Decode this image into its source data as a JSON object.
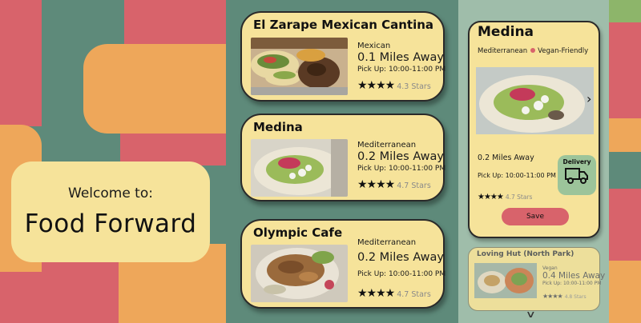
{
  "welcome": {
    "intro": "Welcome to:",
    "app_name": "Food Forward"
  },
  "restaurants": [
    {
      "name": "El Zarape Mexican Cantina",
      "cuisine": "Mexican",
      "distance": "0.1 Miles Away",
      "pickup": "Pick Up: 10:00-11:00 PM",
      "stars": "★★★★",
      "rating": "4.3 Stars"
    },
    {
      "name": "Medina",
      "cuisine": "Mediterranean",
      "distance": "0.2 Miles Away",
      "pickup": "Pick Up: 10:00-11:00 PM",
      "stars": "★★★★",
      "rating": "4.7 Stars"
    },
    {
      "name": "Olympic Cafe",
      "cuisine": "Mediterranean",
      "distance": "0.2 Miles Away",
      "pickup": "Pick Up: 10:00-11:00 PM",
      "stars": "★★★★",
      "rating": "4.7 Stars"
    }
  ],
  "detail": {
    "name": "Medina",
    "cuisine": "Mediterranean",
    "tag": "Vegan-Friendly",
    "distance": "0.2 Miles Away",
    "pickup": "Pick Up: 10:00-11:00 PM",
    "stars": "★★★★",
    "rating": "4.7 Stars",
    "delivery_label": "Delivery",
    "save_label": "Save",
    "next_icon": "chevron-right-icon"
  },
  "more": {
    "name": "Loving Hut (North Park)",
    "cuisine": "Vegan",
    "distance": "0.4 Miles Away",
    "pickup": "Pick Up: 10:00-11:00 PM",
    "stars": "★★★★",
    "rating": "4.8 Stars",
    "scroll_icon": "chevron-down-icon"
  },
  "colors": {
    "green": "#5e8a7a",
    "yellow": "#f6e39a",
    "red": "#d8636b",
    "orange": "#eea75a",
    "light_green": "#8db56a",
    "sage": "#9fbdaa",
    "delivery_bg": "#9cc49a"
  }
}
